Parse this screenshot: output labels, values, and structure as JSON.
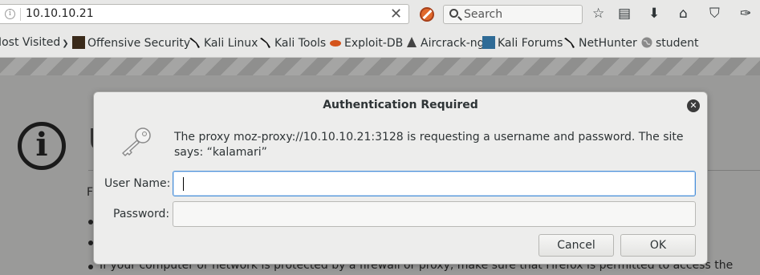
{
  "toolbar": {
    "url": "10.10.10.21",
    "search_placeholder": "Search",
    "clear_glyph": "✕",
    "star_glyph": "☆",
    "library_glyph": "▤",
    "download_glyph": "⬇",
    "home_glyph": "⌂",
    "pocket_glyph": "⛉",
    "ext_glyph": "✑"
  },
  "bookmarks": [
    {
      "label": "Most Visited",
      "icon": "chevron-down-icon"
    },
    {
      "label": "Offensive Security",
      "icon": "offsec-icon"
    },
    {
      "label": "Kali Linux",
      "icon": "kali-dragon-icon"
    },
    {
      "label": "Kali Tools",
      "icon": "kali-dragon-icon"
    },
    {
      "label": "Exploit-DB",
      "icon": "exploit-db-icon"
    },
    {
      "label": "Aircrack-ng",
      "icon": "aircrack-icon"
    },
    {
      "label": "Kali Forums",
      "icon": "kali-forums-icon"
    },
    {
      "label": "NetHunter",
      "icon": "kali-dragon-icon"
    },
    {
      "label": "student",
      "icon": "globe-icon"
    }
  ],
  "background_page": {
    "title_fragment": "U",
    "text_fragment": "F",
    "line": "If your computer or network is protected by a firewall or proxy, make sure that Firefox is permitted to access the"
  },
  "dialog": {
    "title": "Authentication Required",
    "close_glyph": "✕",
    "message": "The proxy moz-proxy://10.10.10.21:3128 is requesting a username and password. The site says: “kalamari”",
    "username_label": "User Name:",
    "username_value": "",
    "password_label": "Password:",
    "password_value": "",
    "cancel_label": "Cancel",
    "ok_label": "OK"
  },
  "colors": {
    "dialog_bg": "#ededec",
    "focus_ring": "#4a90d9",
    "page_dim": "#9a9a99"
  }
}
